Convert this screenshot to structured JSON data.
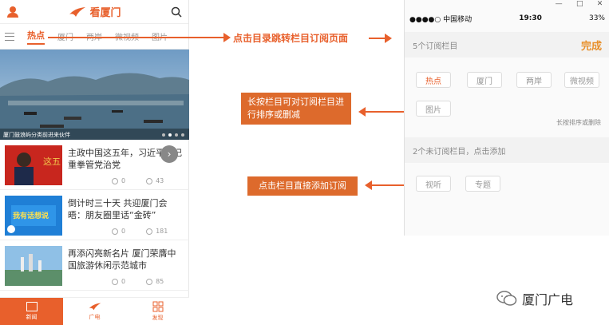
{
  "left": {
    "brand": "看厦门",
    "tabs": [
      "热点",
      "厦门",
      "两岸",
      "微视频",
      "图片"
    ],
    "hero_caption": "厦门鼓浪屿分类前进来伙伴",
    "news": [
      {
        "title": "主政中国这五年，习近平三记重拳管党治党",
        "comments": "0",
        "views": "43"
      },
      {
        "title": "倒计时三十天 共迎厦门会晤：朋友圈里话“金砖”",
        "comments": "0",
        "views": "181"
      },
      {
        "title": "再添闪亮新名片 厦门荣膺中国旅游休闲示范城市",
        "comments": "0",
        "views": "85"
      }
    ],
    "thumb_text": "我有话想说",
    "bottom_nav": [
      "新闻",
      "广电",
      "发现"
    ]
  },
  "annotations": {
    "top": "点击目录跳转栏目订阅页面",
    "middle": "长按栏目可对订阅栏目进行排序或删减",
    "bottom": "点击栏目直接添加订阅"
  },
  "right": {
    "window_controls": [
      "—",
      "□",
      "✕"
    ],
    "status": {
      "carrier": "●●●●○ 中国移动",
      "time": "19:30",
      "battery": "33%"
    },
    "subscribed_header": "5个订阅栏目",
    "done_label": "完成",
    "subscribed": [
      "热点",
      "厦门",
      "两岸",
      "微视频",
      "图片"
    ],
    "sort_hint": "长按排序或删除",
    "unsubscribed_header": "2个未订阅栏目，点击添加",
    "unsubscribed": [
      "视听",
      "专题"
    ]
  },
  "watermark": "厦门广电",
  "colors": {
    "accent": "#e8602c"
  }
}
